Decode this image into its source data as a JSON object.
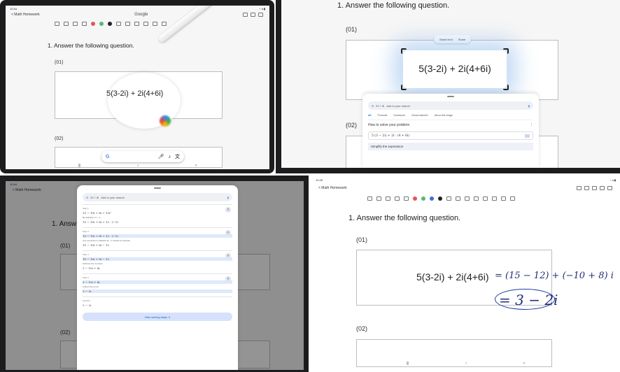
{
  "p1": {
    "status_left": "12:44",
    "status_right": "◔ ◂ ▮",
    "back_label": "< Math Homework",
    "center_label": "Google",
    "question": "1. Answer the following question.",
    "q1": "(01)",
    "q2": "(02)",
    "expression": "5(3-2i) + 2i(4+6i)"
  },
  "p2": {
    "question": "1. Answer the following question.",
    "q1": "(01)",
    "q2": "(02)",
    "expression": "5(3-2i) + 2i(4+6i)",
    "select_text": "Select text",
    "share": "Share",
    "search_chip": "20 + 8i",
    "search_placeholder": "Add to your search",
    "tabs": [
      "All",
      "Products",
      "Homework",
      "Visual matches",
      "About this image"
    ],
    "how_to": "How to solve your problem",
    "equation": "5 (3 − 2i) + 2i · (4 + 6i)",
    "simplify": "Simplify the expression"
  },
  "p3": {
    "status_left": "12:44",
    "back_label": "< Math Homework",
    "question": "1. Answ",
    "q1": "(01)",
    "q2": "(02)",
    "search_chip": "20 + 8i",
    "search_placeholder": "Add to your search",
    "steps": [
      {
        "label": "Step 1",
        "line1": "15 − 10i + 8i + 12i²",
        "note": "By definition i² = −1",
        "line2": "15 − 10i + 8i + 12 · (−1)"
      },
      {
        "label": "Step 3",
        "line1": "15 − 10i + 8i + 12 · (−1)",
        "note": "Any expression multiplied by −1 equals its opposite",
        "line2": "15 − 10i + 8i − 12"
      },
      {
        "label": "Step 4",
        "line1": "15 − 10i + 8i − 12",
        "note": "Subtract the numbers",
        "line2": "3 − 10i + 8i"
      },
      {
        "label": "Step 5",
        "line1": "3 − 10i + 8i",
        "note": "Collect like terms",
        "line2": "3 − 2i"
      }
    ],
    "solution_label": "Solution",
    "solution": "3 − 2i",
    "hide_steps": "Hide solving steps  ∧"
  },
  "p4": {
    "status_left": "12:45",
    "status_right": "◔ ◂ ▮",
    "back_label": "< Math Homework",
    "question": "1. Answer the following question.",
    "q1": "(01)",
    "q2": "(02)",
    "expression": "5(3-2i) + 2i(4+6i)",
    "handwriting_1": "= (15 − 12) + (−10 + 8) i",
    "handwriting_2": "= 3 − 2i"
  },
  "nav": {
    "recent": "|||",
    "home": "○",
    "back": "<"
  },
  "colors": {
    "pen_colors": [
      "#e25757",
      "#56b874",
      "#3c6fd8",
      "#222222"
    ],
    "handwriting": "#1f2f77",
    "google_blue": "#4285f4"
  }
}
